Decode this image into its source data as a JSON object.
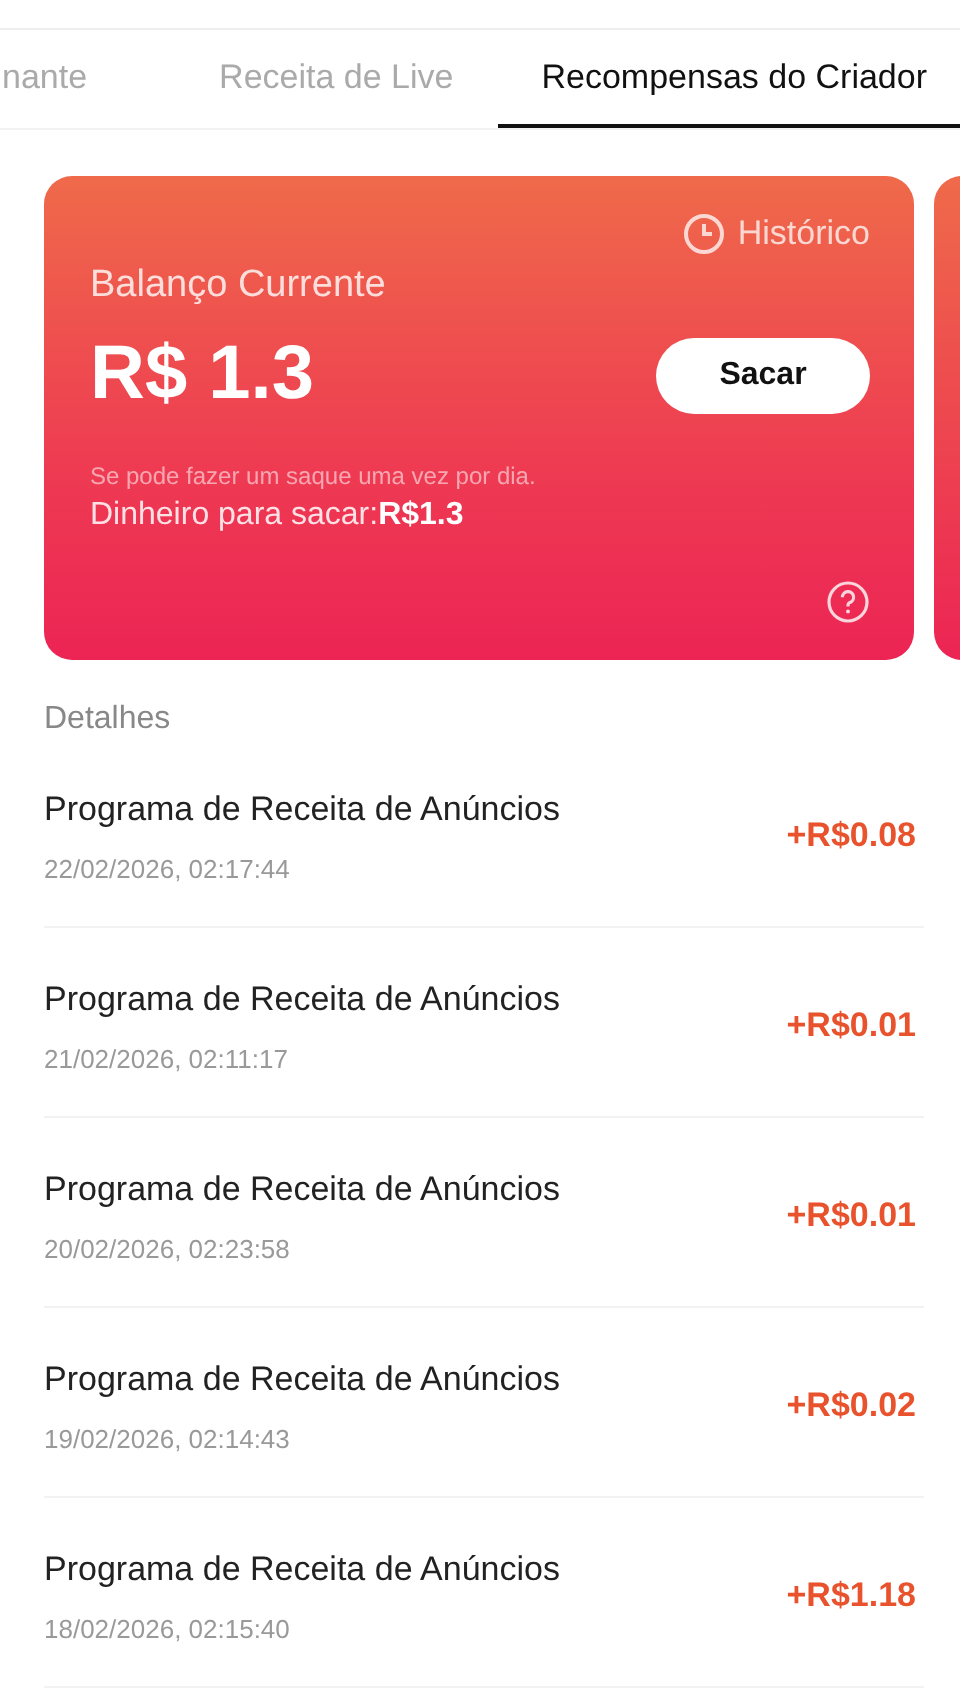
{
  "tabs": [
    {
      "label": "nante",
      "selected": false
    },
    {
      "label": "Receita de Live",
      "selected": false
    },
    {
      "label": "Recompensas do Criador",
      "selected": true
    }
  ],
  "balance_card": {
    "history_link": "Histórico",
    "title": "Balanço Currente",
    "amount": "R$ 1.3",
    "withdraw_button": "Sacar",
    "note": "Se pode fazer um saque uma vez por dia.",
    "available_label": "Dinheiro para sacar:",
    "available_amount": "R$1.3"
  },
  "details": {
    "heading": "Detalhes",
    "items": [
      {
        "title": "Programa de Receita de Anúncios",
        "date": "22/02/2026, 02:17:44",
        "amount": "+R$0.08"
      },
      {
        "title": "Programa de Receita de Anúncios",
        "date": "21/02/2026, 02:11:17",
        "amount": "+R$0.01"
      },
      {
        "title": "Programa de Receita de Anúncios",
        "date": "20/02/2026, 02:23:58",
        "amount": "+R$0.01"
      },
      {
        "title": "Programa de Receita de Anúncios",
        "date": "19/02/2026, 02:14:43",
        "amount": "+R$0.02"
      },
      {
        "title": "Programa de Receita de Anúncios",
        "date": "18/02/2026, 02:15:40",
        "amount": "+R$1.18"
      }
    ]
  }
}
